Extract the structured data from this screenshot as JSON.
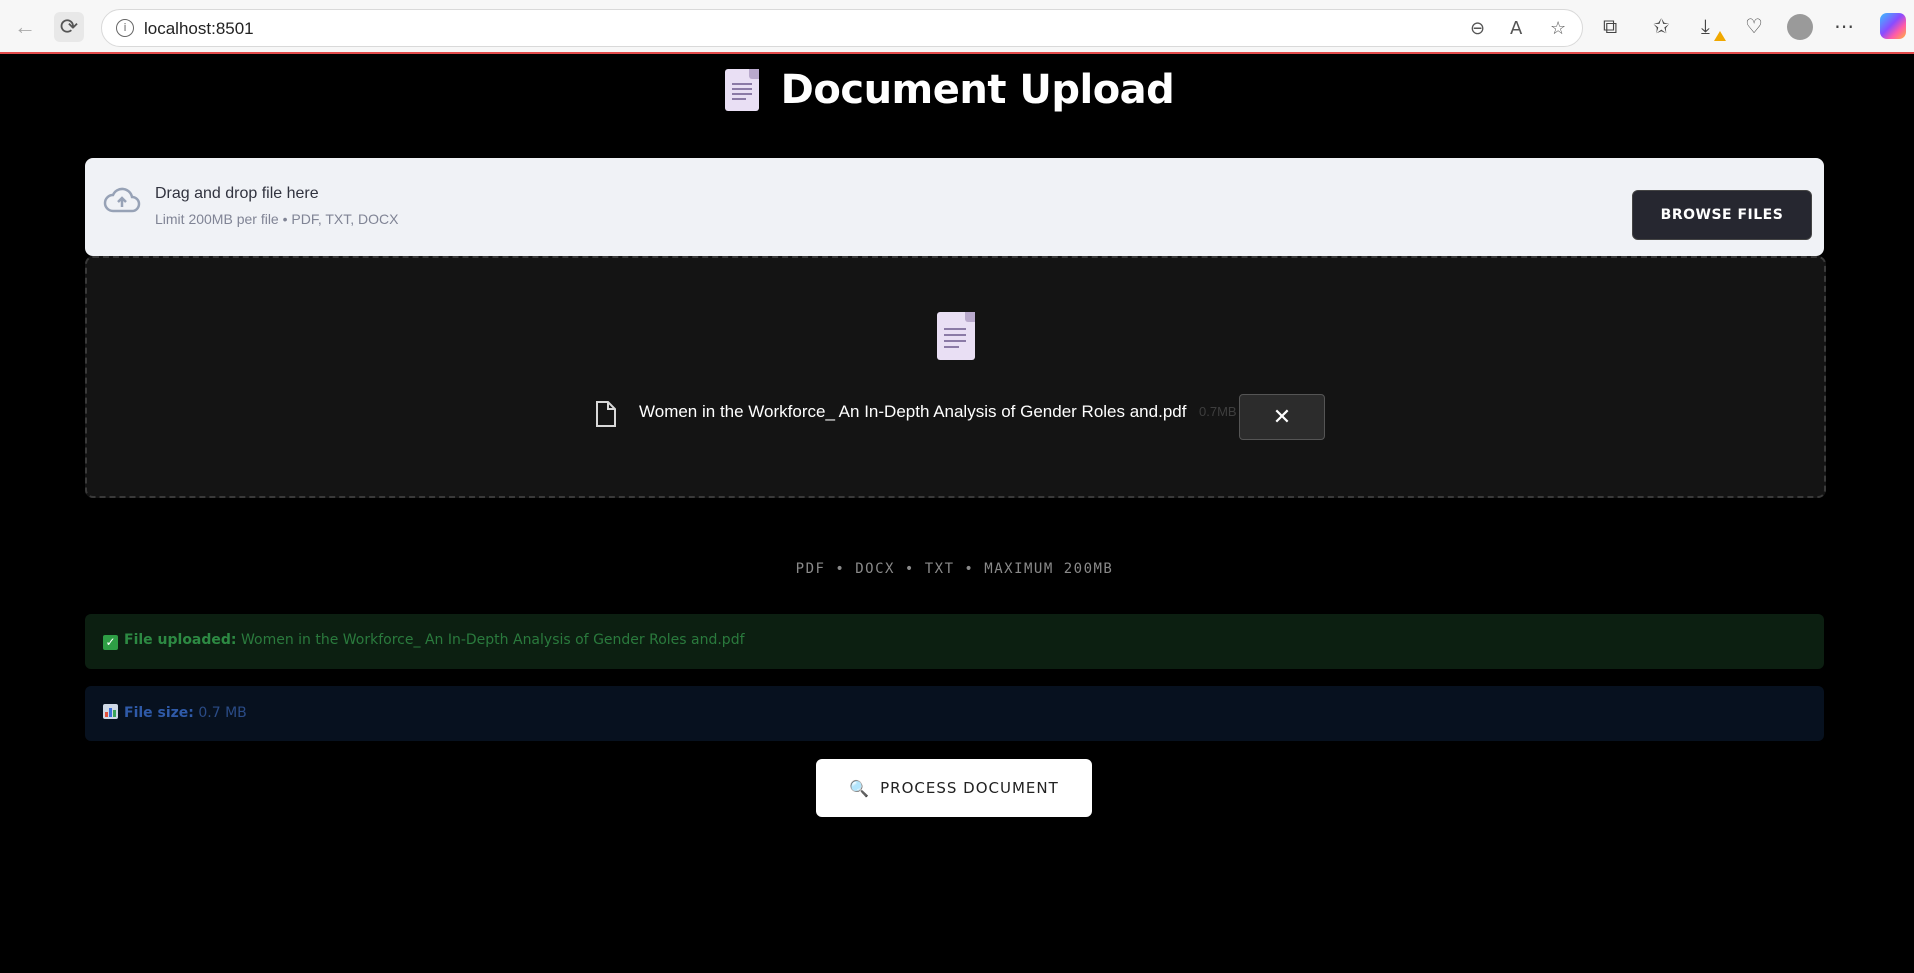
{
  "browser": {
    "url": "localhost:8501",
    "accent_color": "#e34b4b"
  },
  "app": {
    "title": "Document Upload",
    "title_icon": "document-icon"
  },
  "uploader": {
    "drag_text": "Drag and drop file here",
    "limit_text": "Limit 200MB per file • PDF, TXT, DOCX",
    "browse_label": "BROWSE FILES",
    "file": {
      "name": "Women in the Workforce_ An In-Depth Analysis of Gender Roles and.pdf",
      "size": "0.7MB",
      "remove_label": "✕"
    }
  },
  "formats_caption": "PDF • DOCX • TXT • MAXIMUM 200MB",
  "alerts": {
    "uploaded_label": "File uploaded:",
    "uploaded_value": "Women in the Workforce_ An In-Depth Analysis of Gender Roles and.pdf",
    "size_label": "File size:",
    "size_value": "0.7 MB"
  },
  "process_button": {
    "label": "PROCESS DOCUMENT",
    "icon": "🔍"
  }
}
